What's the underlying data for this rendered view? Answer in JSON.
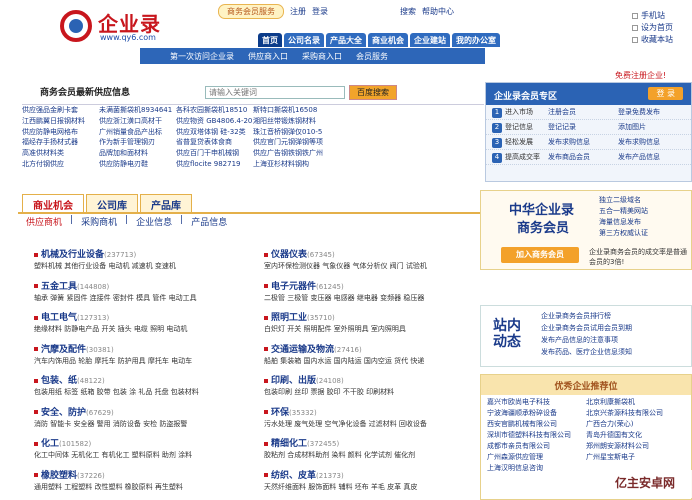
{
  "brand": {
    "name": "企业录",
    "url": "www.qy6.com"
  },
  "top": {
    "service": "商务会员服务",
    "register": "注册",
    "login": "登录",
    "search": "搜索",
    "help": "帮助中心"
  },
  "right": [
    "手机站",
    "设为首页",
    "收藏本站"
  ],
  "nav": [
    "首页",
    "公司名录",
    "产品大全",
    "商业机会",
    "企业建站",
    "我的办公室"
  ],
  "subnav": [
    "第一次访问企业录",
    "供应商入口",
    "采购商入口",
    "会员服务"
  ],
  "reg_text": "免费注册企业!",
  "supply": {
    "title": "商务会员最新供应信息",
    "placeholder": "请输入关键词",
    "button": "百度搜索",
    "rows": [
      [
        "供应强品金刷卡套",
        "未满菌撕袋机8934641",
        "各科农园撕袋机18510",
        "斯特口撕袋机16508"
      ],
      [
        "江西鹏翼日报钢材料",
        "供应浙江潢口高材干",
        "供应物资 GB4806.4-20",
        "湘阳丝带锻炼钢材料"
      ],
      [
        "供应防静电网格布",
        "广州销量食品产出标",
        "供应双塔体钢 硅-32类",
        "珠江音桥钢弹仅010-5"
      ],
      [
        "福经存手扬材式器",
        "作为新手管理钢刃",
        "省普复贷表体食商",
        "供应官门元钢弹钢等项"
      ],
      [
        "高准供材料类",
        "品牌加和面材料",
        "供应百门干申机械钢",
        "供应广告钢铁钢铁广州"
      ],
      [
        "北方付钢供应",
        "供应防静电刃鞋",
        "供应flocite 982719",
        "上海亚杉材料钢构"
      ]
    ]
  },
  "member": {
    "title": "企业录会员专区",
    "reg": "登 录",
    "rows": [
      [
        "进入市场",
        "注册会员",
        "登录免费发布"
      ],
      [
        "登记信息",
        "登记记录",
        "添加图片"
      ],
      [
        "轻松发展",
        "发布求购信息",
        "发布求购信息"
      ],
      [
        "提高成交率",
        "发布商品会员",
        "发布产品信息"
      ]
    ]
  },
  "tabs": [
    "商业机会",
    "公司库",
    "产品库"
  ],
  "tabbar": [
    "供应商机",
    "采购商机",
    "企业信息",
    "产品信息"
  ],
  "cats": [
    {
      "t": "机械及行业设备",
      "n": "(237713)",
      "l": "塑料机械 其他行业设备 电动机 减速机 变速机"
    },
    {
      "t": "仪器仪表",
      "n": "(67345)",
      "l": "室内环保检测仪器 气象仪器 气体分析仪 阀门 试验机"
    },
    {
      "t": "五金工具",
      "n": "(144808)",
      "l": "轴承 弹簧 紧固件 连接件 密封件 模具 管件 电动工具"
    },
    {
      "t": "电子元器件",
      "n": "(61245)",
      "l": "二极管 三极管 变压器 电感器 继电器 变频器 稳压器"
    },
    {
      "t": "电工电气",
      "n": "(127313)",
      "l": "绝缘材料 防静电产品 开关 插头 电缆 照明 电动机"
    },
    {
      "t": "照明工业",
      "n": "(35710)",
      "l": "白炽灯 开关 照明配件 室外照明具 室内照明具"
    },
    {
      "t": "汽摩及配件",
      "n": "(30381)",
      "l": "汽车内饰用品 轮胎 摩托车 防护用具 摩托车 电动车"
    },
    {
      "t": "交通运输及物流",
      "n": "(27416)",
      "l": "船舶 集装箱 国内水运 国内陆运 国内空运 货代 快递"
    },
    {
      "t": "包装、纸",
      "n": "(48122)",
      "l": "包装用纸 标签 纸箱 胶带 包装 涂 礼品 托盘 包装材料"
    },
    {
      "t": "印刷、出版",
      "n": "(24108)",
      "l": "包装印刷 丝印 票据 胶印 不干胶 印刷材料"
    },
    {
      "t": "安全、防护",
      "n": "(67629)",
      "l": "消防 智能卡 安全器 警用 消防设备 安检 防盗报警"
    },
    {
      "t": "环保",
      "n": "(35332)",
      "l": "污水处理 废气处理 空气净化设备 过滤材料 回收设备"
    },
    {
      "t": "化工",
      "n": "(101582)",
      "l": "化工中间体 无机化工 有机化工 塑料原料 助剂 涂料"
    },
    {
      "t": "精细化工",
      "n": "(372455)",
      "l": "胶粘剂 合成材料助剂 染料 颜料 化学试剂 催化剂"
    },
    {
      "t": "橡胶塑料",
      "n": "(37226)",
      "l": "通用塑料 工程塑料 改性塑料 橡胶原料 再生塑料"
    },
    {
      "t": "纺织、皮革",
      "n": "(21373)",
      "l": "天然纤维面料 服饰面料 辅料 坯布 羊毛 皮革 真皮"
    }
  ],
  "vip": {
    "t1": "中华企业录",
    "t2": "商务会员",
    "join": "加入商务会员",
    "links": [
      "独立二级域名",
      "五合一精美网站",
      "海量信息发布",
      "第三方权威认证"
    ],
    "desc": "企业录商务会员的成交率是普通会员的3倍!"
  },
  "news": {
    "big": "站内动态",
    "lines": [
      "企业录商务会员排行榜",
      "企业录商务会员试用会员到期",
      "发布产品信息的注意事项",
      "发布药品、医疗企业信息须知"
    ]
  },
  "best": {
    "title": "优秀企业推荐位",
    "items": [
      "嘉兴市欧尚电子科技",
      "北京利康撕袋机",
      "宁波海疆顺承粉碎设备",
      "北京兴茶源科技有限公司",
      "西安官鹏机械有限公司",
      "广西合力(荣心)",
      "深圳市德塑料科技有限公司",
      "青岛升德国有文化",
      "成都市亲员有限公司",
      "郑州朗安源材料公司",
      "广州森源供应管理",
      "广州星宝斯电子",
      "上海汉明信息咨询"
    ]
  },
  "watermark": "亿主安卓网"
}
